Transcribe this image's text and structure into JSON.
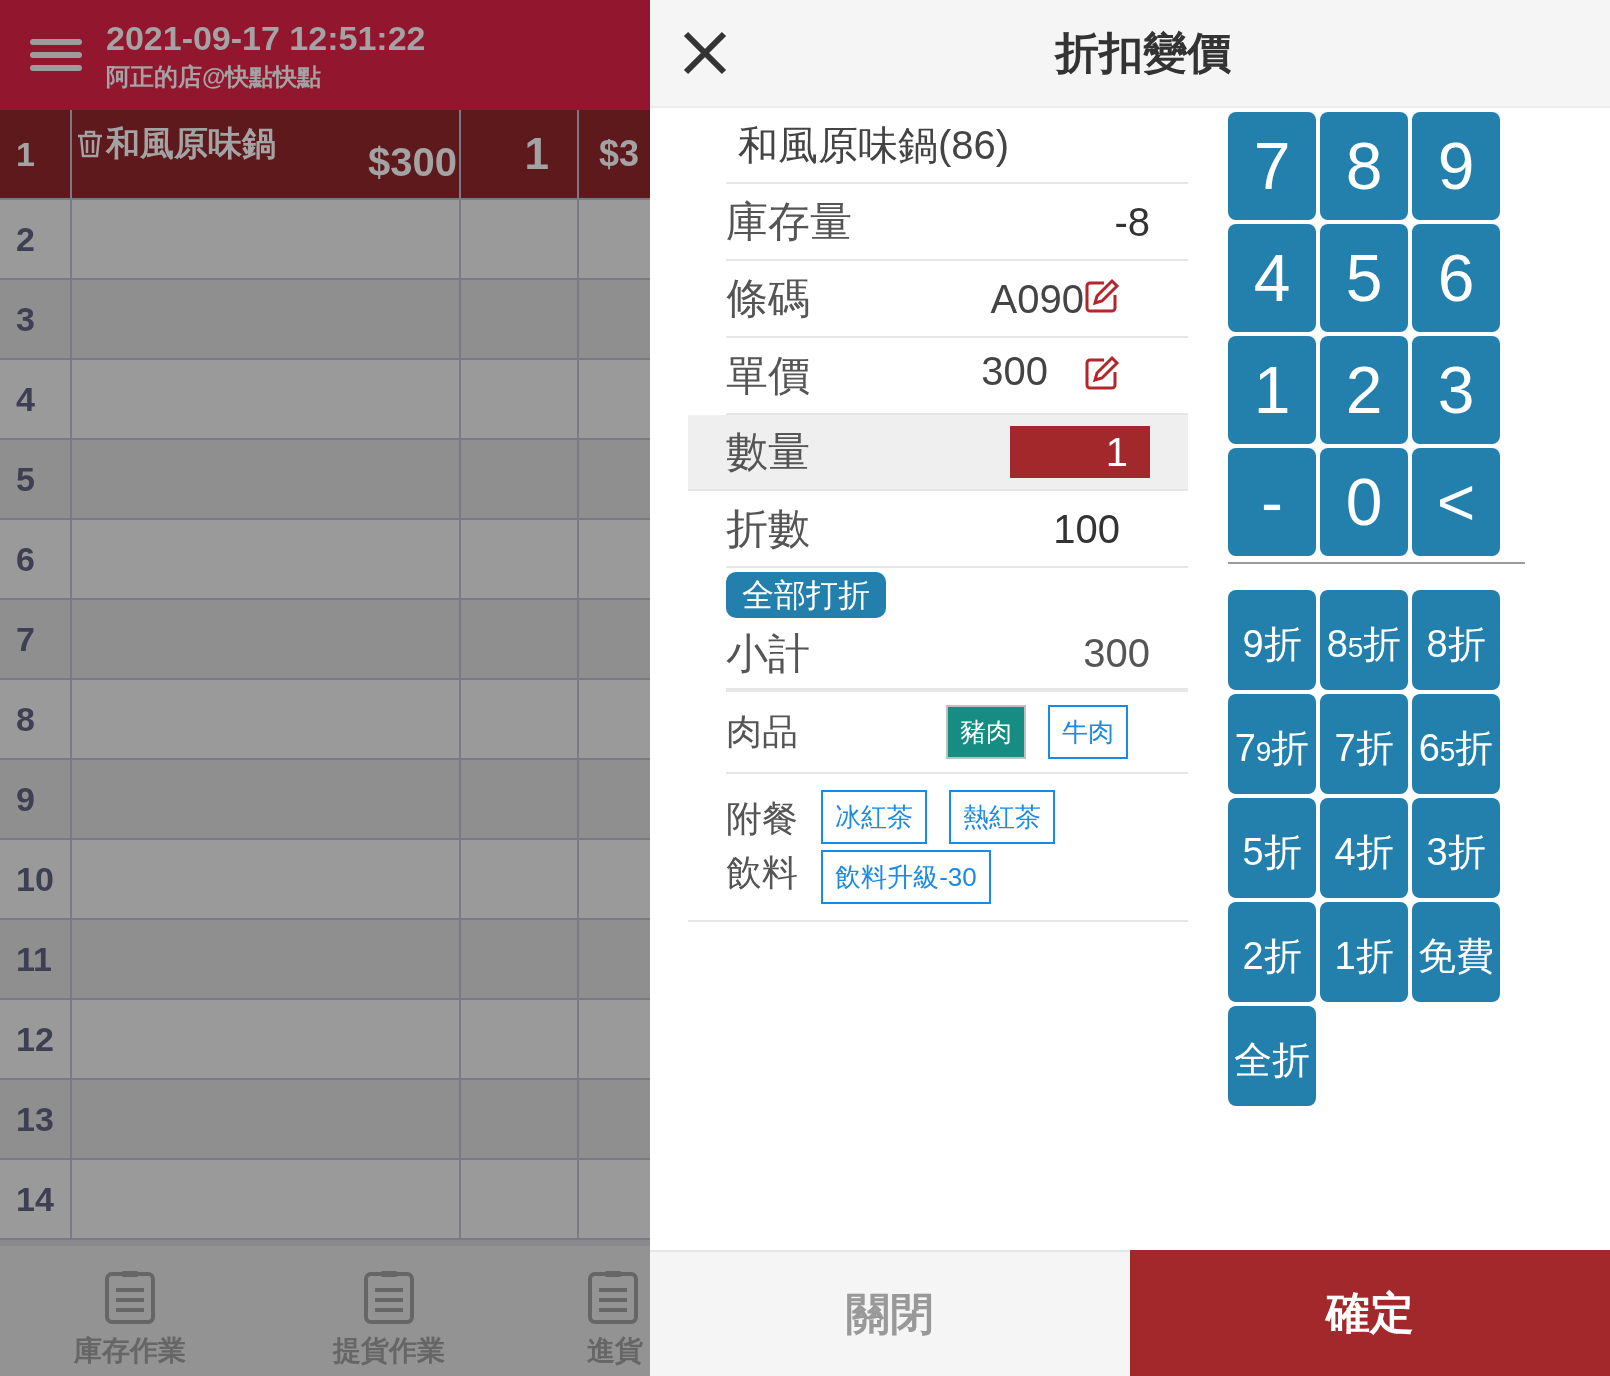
{
  "header": {
    "datetime": "2021-09-17 12:51:22",
    "store": "阿正的店@快點快點"
  },
  "order_rows": [
    {
      "number": "1",
      "name": "和風原味鍋",
      "price": "$300",
      "qty": "1",
      "total": "$3",
      "selected": true
    },
    {
      "number": "2",
      "selected": false
    },
    {
      "number": "3",
      "selected": false
    },
    {
      "number": "4",
      "selected": false
    },
    {
      "number": "5",
      "selected": false
    },
    {
      "number": "6",
      "selected": false
    },
    {
      "number": "7",
      "selected": false
    },
    {
      "number": "8",
      "selected": false
    },
    {
      "number": "9",
      "selected": false
    },
    {
      "number": "10",
      "selected": false
    },
    {
      "number": "11",
      "selected": false
    },
    {
      "number": "12",
      "selected": false
    },
    {
      "number": "13",
      "selected": false
    },
    {
      "number": "14",
      "selected": false
    }
  ],
  "bottom_nav": [
    {
      "label": "庫存作業"
    },
    {
      "label": "提貨作業"
    },
    {
      "label": "進貨"
    }
  ],
  "dialog": {
    "title": "折扣變價",
    "product": "和風原味鍋(86)",
    "fields": [
      {
        "kind": "plain",
        "label": "庫存量",
        "value": "-8"
      },
      {
        "kind": "editable",
        "label": "條碼",
        "value": "A090"
      },
      {
        "kind": "editable",
        "label": "單價",
        "value": "300"
      },
      {
        "kind": "input",
        "label": "數量",
        "value": "1",
        "selected": true
      },
      {
        "kind": "plain",
        "label": "折數",
        "value": "100"
      }
    ],
    "discount_all_button": "全部打折",
    "subtotal": {
      "label": "小計",
      "value": "300"
    },
    "option_groups": [
      {
        "label": "肉品",
        "options": [
          {
            "label": "豬肉",
            "selected": true
          },
          {
            "label": "牛肉",
            "selected": false
          }
        ]
      },
      {
        "label": "附餐飲料",
        "options": [
          {
            "label": "冰紅茶",
            "selected": false
          },
          {
            "label": "熱紅茶",
            "selected": false
          },
          {
            "label": "飲料升級-30",
            "selected": false
          }
        ]
      }
    ],
    "keypad": [
      "7",
      "8",
      "9",
      "4",
      "5",
      "6",
      "1",
      "2",
      "3",
      "-",
      "0",
      "<"
    ],
    "discount_buttons": [
      "9折",
      "8$_{5}$折",
      "8折",
      "7$_{9}$折",
      "7折",
      "6$_{5}$折",
      "5折",
      "4折",
      "3折",
      "2折",
      "1折",
      "免費",
      "全折"
    ],
    "close_button": "關閉",
    "confirm_button": "確定"
  }
}
